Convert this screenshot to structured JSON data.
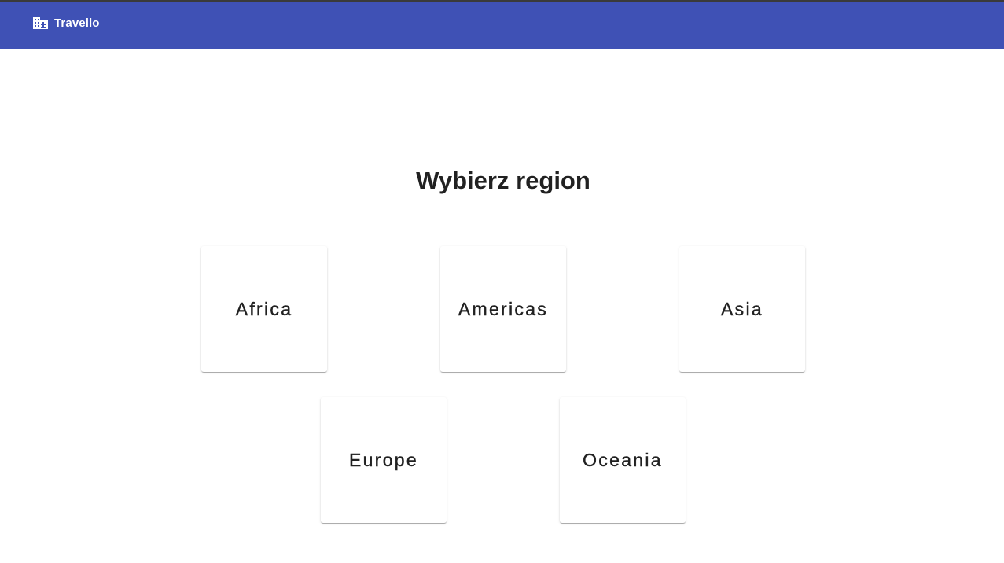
{
  "header": {
    "brand_icon": "business-building-icon",
    "brand_name": "Travello",
    "bar_color": "#3f51b5"
  },
  "main": {
    "title": "Wybierz region",
    "regions": [
      {
        "label": "Africa"
      },
      {
        "label": "Americas"
      },
      {
        "label": "Asia"
      },
      {
        "label": "Europe"
      },
      {
        "label": "Oceania"
      }
    ]
  }
}
